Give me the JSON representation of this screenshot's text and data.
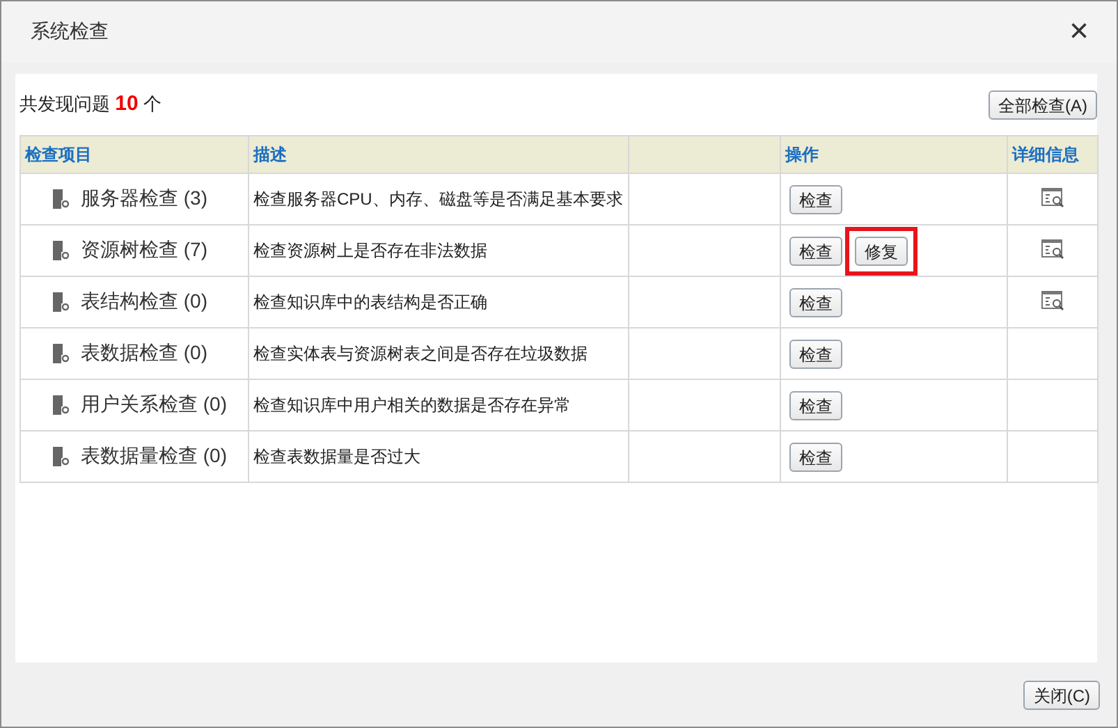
{
  "window": {
    "title": "系统检查",
    "close": "×"
  },
  "summary": {
    "prefix": "共发现问题",
    "count": "10",
    "suffix": "个"
  },
  "check_all_button": "全部检查(A)",
  "table": {
    "columns": [
      "检查项目",
      "描述",
      "操作",
      "详细信息"
    ],
    "rows": [
      {
        "name": "服务器检查 (3)",
        "description": "检查服务器CPU、内存、磁盘等是否满足基本要求",
        "check": "检查",
        "has_details": true
      },
      {
        "name": "资源树检查 (7)",
        "description": "检查资源树上是否存在非法数据",
        "check": "检查",
        "fix": {
          "label": "修复",
          "highlighted": true
        },
        "has_details": true
      },
      {
        "name": "表结构检查 (0)",
        "description": "检查知识库中的表结构是否正确",
        "check": "检查",
        "has_details": true
      },
      {
        "name": "表数据检查 (0)",
        "description": "检查实体表与资源树表之间是否存在垃圾数据",
        "check": "检查",
        "has_details": false
      },
      {
        "name": "用户关系检查 (0)",
        "description": "检查知识库中用户相关的数据是否存在异常",
        "check": "检查",
        "has_details": false
      },
      {
        "name": "表数据量检查 (0)",
        "description": "检查表数据量是否过大",
        "check": "检查",
        "has_details": false
      }
    ]
  },
  "close_button": "关闭(C)"
}
